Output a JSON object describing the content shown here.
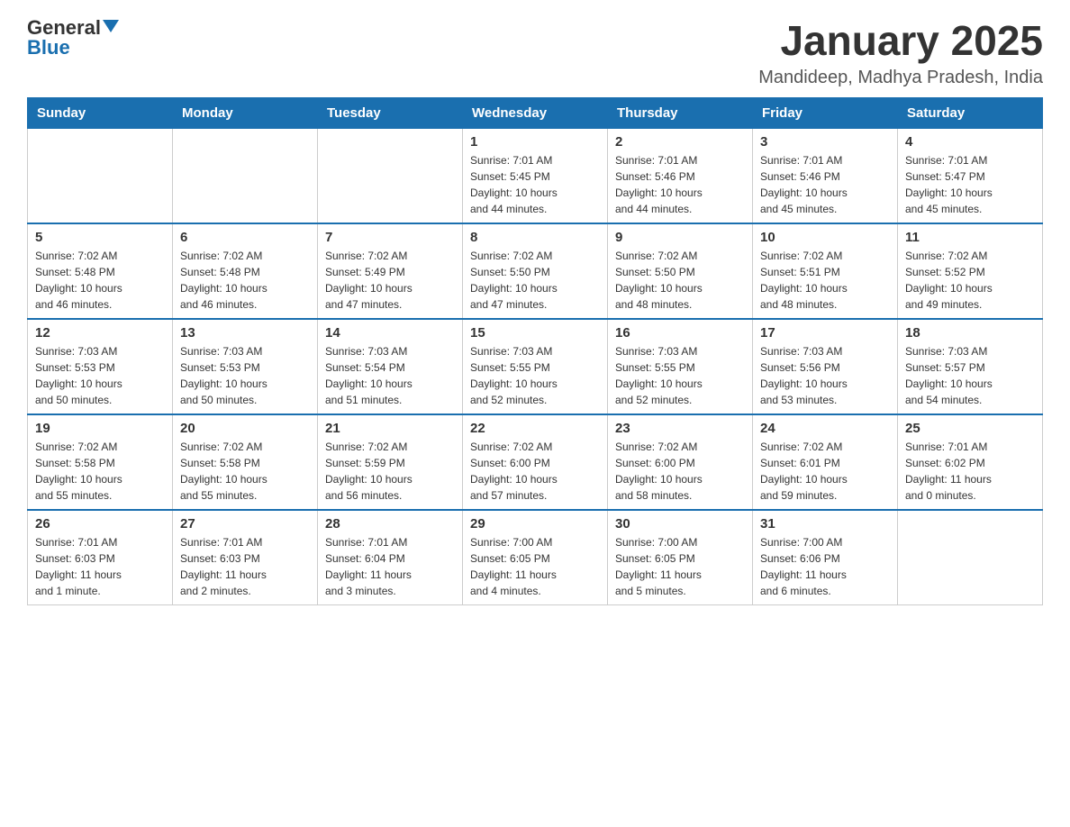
{
  "logo": {
    "general": "General",
    "blue": "Blue"
  },
  "title": "January 2025",
  "location": "Mandideep, Madhya Pradesh, India",
  "headers": [
    "Sunday",
    "Monday",
    "Tuesday",
    "Wednesday",
    "Thursday",
    "Friday",
    "Saturday"
  ],
  "weeks": [
    [
      {
        "day": "",
        "info": ""
      },
      {
        "day": "",
        "info": ""
      },
      {
        "day": "",
        "info": ""
      },
      {
        "day": "1",
        "info": "Sunrise: 7:01 AM\nSunset: 5:45 PM\nDaylight: 10 hours\nand 44 minutes."
      },
      {
        "day": "2",
        "info": "Sunrise: 7:01 AM\nSunset: 5:46 PM\nDaylight: 10 hours\nand 44 minutes."
      },
      {
        "day": "3",
        "info": "Sunrise: 7:01 AM\nSunset: 5:46 PM\nDaylight: 10 hours\nand 45 minutes."
      },
      {
        "day": "4",
        "info": "Sunrise: 7:01 AM\nSunset: 5:47 PM\nDaylight: 10 hours\nand 45 minutes."
      }
    ],
    [
      {
        "day": "5",
        "info": "Sunrise: 7:02 AM\nSunset: 5:48 PM\nDaylight: 10 hours\nand 46 minutes."
      },
      {
        "day": "6",
        "info": "Sunrise: 7:02 AM\nSunset: 5:48 PM\nDaylight: 10 hours\nand 46 minutes."
      },
      {
        "day": "7",
        "info": "Sunrise: 7:02 AM\nSunset: 5:49 PM\nDaylight: 10 hours\nand 47 minutes."
      },
      {
        "day": "8",
        "info": "Sunrise: 7:02 AM\nSunset: 5:50 PM\nDaylight: 10 hours\nand 47 minutes."
      },
      {
        "day": "9",
        "info": "Sunrise: 7:02 AM\nSunset: 5:50 PM\nDaylight: 10 hours\nand 48 minutes."
      },
      {
        "day": "10",
        "info": "Sunrise: 7:02 AM\nSunset: 5:51 PM\nDaylight: 10 hours\nand 48 minutes."
      },
      {
        "day": "11",
        "info": "Sunrise: 7:02 AM\nSunset: 5:52 PM\nDaylight: 10 hours\nand 49 minutes."
      }
    ],
    [
      {
        "day": "12",
        "info": "Sunrise: 7:03 AM\nSunset: 5:53 PM\nDaylight: 10 hours\nand 50 minutes."
      },
      {
        "day": "13",
        "info": "Sunrise: 7:03 AM\nSunset: 5:53 PM\nDaylight: 10 hours\nand 50 minutes."
      },
      {
        "day": "14",
        "info": "Sunrise: 7:03 AM\nSunset: 5:54 PM\nDaylight: 10 hours\nand 51 minutes."
      },
      {
        "day": "15",
        "info": "Sunrise: 7:03 AM\nSunset: 5:55 PM\nDaylight: 10 hours\nand 52 minutes."
      },
      {
        "day": "16",
        "info": "Sunrise: 7:03 AM\nSunset: 5:55 PM\nDaylight: 10 hours\nand 52 minutes."
      },
      {
        "day": "17",
        "info": "Sunrise: 7:03 AM\nSunset: 5:56 PM\nDaylight: 10 hours\nand 53 minutes."
      },
      {
        "day": "18",
        "info": "Sunrise: 7:03 AM\nSunset: 5:57 PM\nDaylight: 10 hours\nand 54 minutes."
      }
    ],
    [
      {
        "day": "19",
        "info": "Sunrise: 7:02 AM\nSunset: 5:58 PM\nDaylight: 10 hours\nand 55 minutes."
      },
      {
        "day": "20",
        "info": "Sunrise: 7:02 AM\nSunset: 5:58 PM\nDaylight: 10 hours\nand 55 minutes."
      },
      {
        "day": "21",
        "info": "Sunrise: 7:02 AM\nSunset: 5:59 PM\nDaylight: 10 hours\nand 56 minutes."
      },
      {
        "day": "22",
        "info": "Sunrise: 7:02 AM\nSunset: 6:00 PM\nDaylight: 10 hours\nand 57 minutes."
      },
      {
        "day": "23",
        "info": "Sunrise: 7:02 AM\nSunset: 6:00 PM\nDaylight: 10 hours\nand 58 minutes."
      },
      {
        "day": "24",
        "info": "Sunrise: 7:02 AM\nSunset: 6:01 PM\nDaylight: 10 hours\nand 59 minutes."
      },
      {
        "day": "25",
        "info": "Sunrise: 7:01 AM\nSunset: 6:02 PM\nDaylight: 11 hours\nand 0 minutes."
      }
    ],
    [
      {
        "day": "26",
        "info": "Sunrise: 7:01 AM\nSunset: 6:03 PM\nDaylight: 11 hours\nand 1 minute."
      },
      {
        "day": "27",
        "info": "Sunrise: 7:01 AM\nSunset: 6:03 PM\nDaylight: 11 hours\nand 2 minutes."
      },
      {
        "day": "28",
        "info": "Sunrise: 7:01 AM\nSunset: 6:04 PM\nDaylight: 11 hours\nand 3 minutes."
      },
      {
        "day": "29",
        "info": "Sunrise: 7:00 AM\nSunset: 6:05 PM\nDaylight: 11 hours\nand 4 minutes."
      },
      {
        "day": "30",
        "info": "Sunrise: 7:00 AM\nSunset: 6:05 PM\nDaylight: 11 hours\nand 5 minutes."
      },
      {
        "day": "31",
        "info": "Sunrise: 7:00 AM\nSunset: 6:06 PM\nDaylight: 11 hours\nand 6 minutes."
      },
      {
        "day": "",
        "info": ""
      }
    ]
  ]
}
